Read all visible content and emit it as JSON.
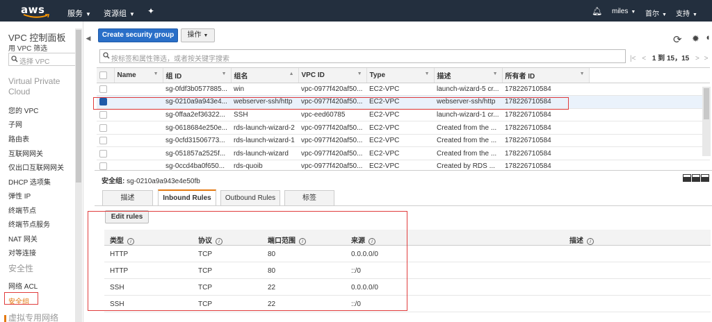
{
  "topbar": {
    "logo": "aws",
    "services": "服务",
    "resource_groups": "资源组",
    "pin_icon": "pin-icon",
    "bell_icon": "bell-icon",
    "user": "miles",
    "region": "首尔",
    "support": "支持"
  },
  "sidebar": {
    "title": "VPC 控制面板",
    "filter_label": "用 VPC 筛选",
    "select_placeholder": "选择 VPC",
    "section_vpc": "Virtual Private Cloud",
    "items_vpc": [
      "您的 VPC",
      "子网",
      "路由表",
      "互联网网关",
      "仅出口互联网网关",
      "DHCP 选项集",
      "弹性 IP",
      "终端节点",
      "终端节点服务",
      "NAT 网关",
      "对等连接"
    ],
    "section_security": "安全性",
    "items_security": [
      "网络 ACL",
      "安全组"
    ],
    "section_vpn": "虚拟专用网络"
  },
  "toolbar": {
    "create_button": "Create security group",
    "actions_button": "操作",
    "search_placeholder": "按标签和属性筛选，或者按关键字搜索",
    "pager_text": "1 到 15，15",
    "refresh_icon": "refresh-icon",
    "settings_icon": "gear-icon",
    "help_icon": "help-icon"
  },
  "sg_table": {
    "headers": [
      "Name",
      "组 ID",
      "组名",
      "VPC ID",
      "Type",
      "描述",
      "所有者 ID"
    ],
    "rows": [
      {
        "name": "",
        "id": "sg-0fdf3b0577885...",
        "group": "win",
        "vpc": "vpc-0977f420af50...",
        "type": "EC2-VPC",
        "desc": "launch-wizard-5 cr...",
        "owner": "178226710584",
        "selected": false
      },
      {
        "name": "",
        "id": "sg-0210a9a943e4...",
        "group": "webserver-ssh/http",
        "vpc": "vpc-0977f420af50...",
        "type": "EC2-VPC",
        "desc": "webserver-ssh/http",
        "owner": "178226710584",
        "selected": true
      },
      {
        "name": "",
        "id": "sg-0ffaa2ef36322...",
        "group": "SSH",
        "vpc": "vpc-eed60785",
        "type": "EC2-VPC",
        "desc": "launch-wizard-1 cr...",
        "owner": "178226710584",
        "selected": false
      },
      {
        "name": "",
        "id": "sg-0618684e250e...",
        "group": "rds-launch-wizard-2",
        "vpc": "vpc-0977f420af50...",
        "type": "EC2-VPC",
        "desc": "Created from the ...",
        "owner": "178226710584",
        "selected": false
      },
      {
        "name": "",
        "id": "sg-0cfd31506773...",
        "group": "rds-launch-wizard-1",
        "vpc": "vpc-0977f420af50...",
        "type": "EC2-VPC",
        "desc": "Created from the ...",
        "owner": "178226710584",
        "selected": false
      },
      {
        "name": "",
        "id": "sg-051857a2525f...",
        "group": "rds-launch-wizard",
        "vpc": "vpc-0977f420af50...",
        "type": "EC2-VPC",
        "desc": "Created from the ...",
        "owner": "178226710584",
        "selected": false
      },
      {
        "name": "",
        "id": "sg-0ccd4ba0f650...",
        "group": "rds-quoib",
        "vpc": "vpc-0977f420af50...",
        "type": "EC2-VPC",
        "desc": "Created by RDS ...",
        "owner": "178226710584",
        "selected": false
      }
    ]
  },
  "details": {
    "label": "安全组:",
    "sg_id": "sg-0210a9a943e4e50fb",
    "tabs": [
      "描述",
      "Inbound Rules",
      "Outbound Rules",
      "标签"
    ],
    "active_tab": "Inbound Rules",
    "edit_button": "Edit rules",
    "rule_headers": [
      "类型",
      "协议",
      "端口范围",
      "来源",
      "描述"
    ],
    "rules": [
      {
        "type": "HTTP",
        "protocol": "TCP",
        "port": "80",
        "source": "0.0.0.0/0",
        "desc": ""
      },
      {
        "type": "HTTP",
        "protocol": "TCP",
        "port": "80",
        "source": "::/0",
        "desc": ""
      },
      {
        "type": "SSH",
        "protocol": "TCP",
        "port": "22",
        "source": "0.0.0.0/0",
        "desc": ""
      },
      {
        "type": "SSH",
        "protocol": "TCP",
        "port": "22",
        "source": "::/0",
        "desc": ""
      }
    ]
  },
  "colors": {
    "topbar_bg": "#232f3e",
    "primary_btn": "#2a6fc8",
    "active_orange": "#e47911",
    "annotation_red": "#e03c3c"
  }
}
